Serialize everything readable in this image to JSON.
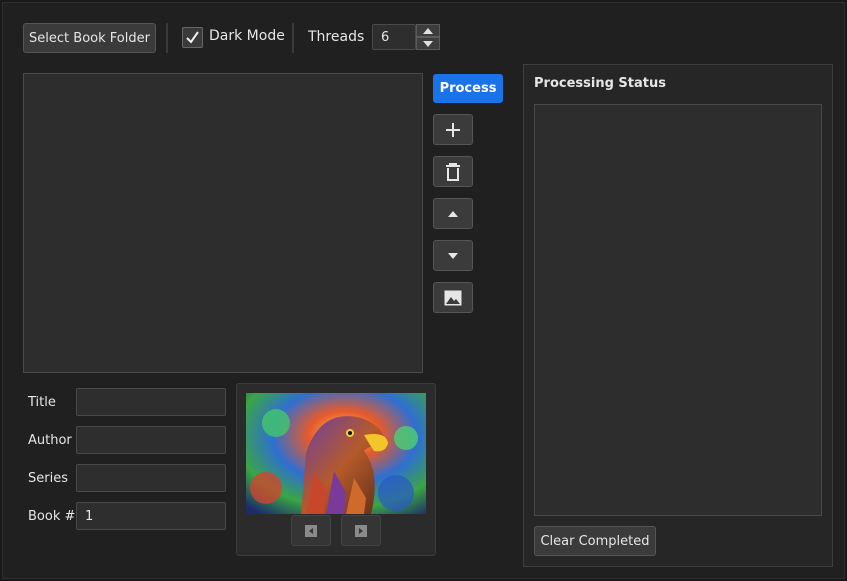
{
  "toolbar": {
    "select_folder_label": "Select Book Folder",
    "dark_mode_label": "Dark Mode",
    "dark_mode_checked": true,
    "threads_label": "Threads",
    "threads_value": "6"
  },
  "actions": {
    "process_label": "Process",
    "add_icon": "plus-icon",
    "delete_icon": "trash-icon",
    "up_icon": "arrow-up-icon",
    "down_icon": "arrow-down-icon",
    "image_icon": "image-icon"
  },
  "metadata": {
    "title_label": "Title",
    "title_value": "",
    "author_label": "Author",
    "author_value": "",
    "series_label": "Series",
    "series_value": "",
    "book_num_label": "Book #",
    "book_num_value": "1"
  },
  "cover": {
    "prev_icon": "previous-icon",
    "next_icon": "next-icon"
  },
  "status": {
    "title": "Processing Status",
    "clear_label": "Clear Completed"
  },
  "colors": {
    "accent": "#1a73e8",
    "background": "#202020",
    "panel": "#2d2d2d"
  }
}
